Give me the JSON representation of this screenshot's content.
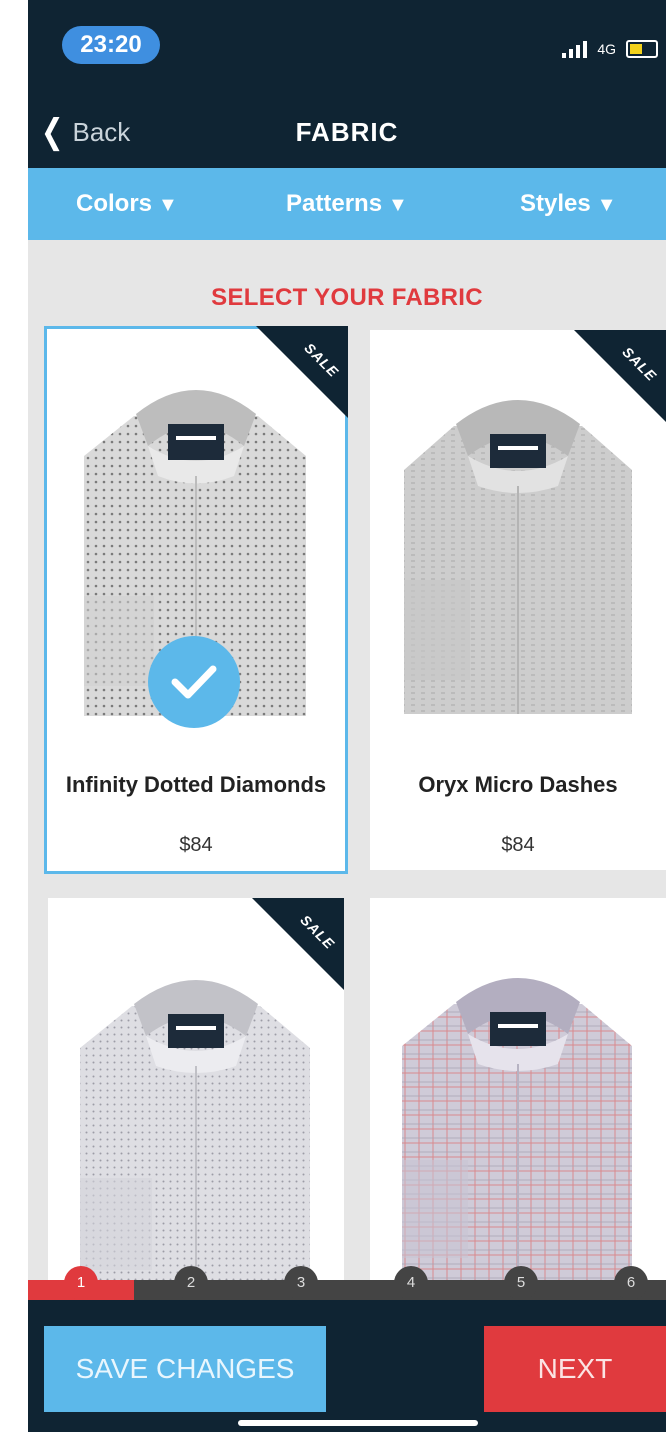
{
  "status_bar": {
    "time": "23:20",
    "network": "4G"
  },
  "nav": {
    "back_label": "Back",
    "title": "FABRIC"
  },
  "filters": [
    {
      "label": "Colors"
    },
    {
      "label": "Patterns"
    },
    {
      "label": "Styles"
    }
  ],
  "section_title": "SELECT YOUR FABRIC",
  "products": [
    {
      "name": "Infinity Dotted Diamonds",
      "price": "$84",
      "sale": "SALE",
      "selected": true
    },
    {
      "name": "Oryx Micro Dashes",
      "price": "$84",
      "sale": "SALE",
      "selected": false
    },
    {
      "name": "",
      "price": "",
      "sale": "SALE",
      "selected": false
    },
    {
      "name": "",
      "price": "",
      "sale": "",
      "selected": false
    }
  ],
  "steps": [
    "1",
    "2",
    "3",
    "4",
    "5",
    "6"
  ],
  "progress": {
    "current_step": 1,
    "total_steps": 6
  },
  "actions": {
    "save_label": "SAVE CHANGES",
    "next_label": "NEXT"
  },
  "colors": {
    "navy": "#0f2433",
    "accent_blue": "#5cb8ea",
    "accent_red": "#e03a3e"
  }
}
